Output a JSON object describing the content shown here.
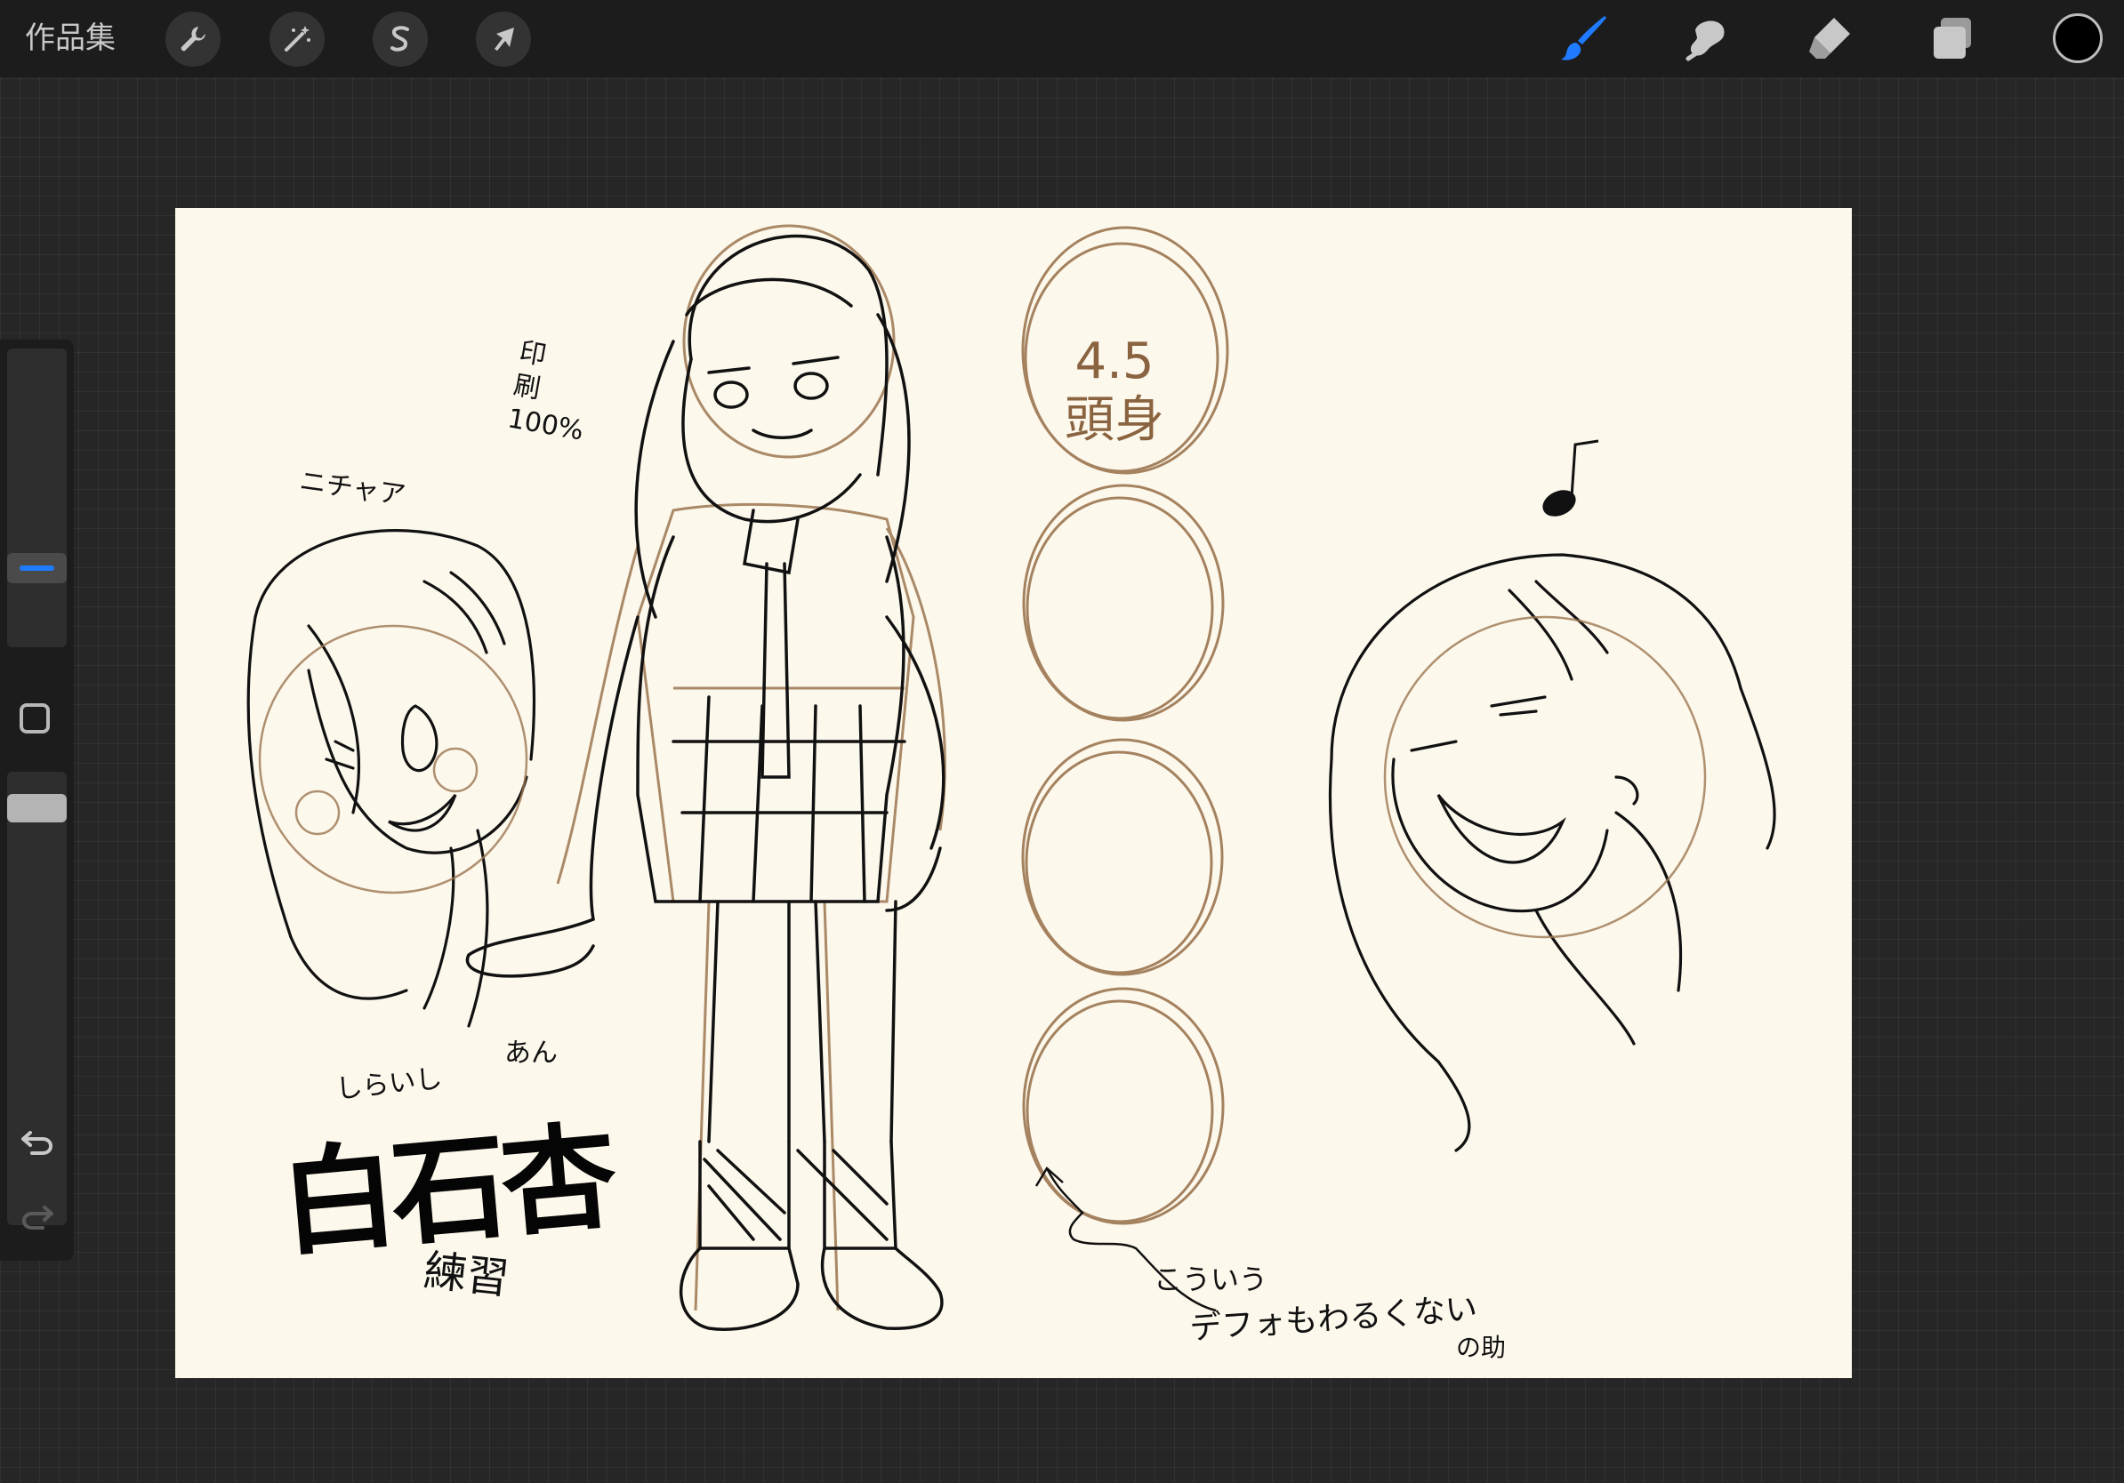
{
  "topbar": {
    "gallery_label": "作品集",
    "left_tools": [
      {
        "icon": "wrench-icon",
        "name": "actions"
      },
      {
        "icon": "magic-wand-icon",
        "name": "adjustments"
      },
      {
        "icon": "selection-s-icon",
        "name": "selection"
      },
      {
        "icon": "arrow-cursor-icon",
        "name": "transform"
      }
    ],
    "right_tools": [
      {
        "icon": "brush-icon",
        "name": "paint",
        "active": true
      },
      {
        "icon": "smudge-icon",
        "name": "smudge"
      },
      {
        "icon": "eraser-icon",
        "name": "eraser"
      },
      {
        "icon": "layers-icon",
        "name": "layers"
      }
    ],
    "current_color": "#000000"
  },
  "sidebar": {
    "brush_size_icon": "size-slider-icon",
    "modify_icon": "square-modify-icon",
    "opacity_icon": "opacity-slider-icon",
    "undo_icon": "undo-arrow-icon",
    "redo_icon": "redo-arrow-icon"
  },
  "canvas": {
    "background": "#fdf8ec",
    "notes": {
      "expression": "ニチャア",
      "print_setting": "印\n刷\n100%",
      "head_ratio": "4.5\n頭身",
      "furigana_surname": "しらいし",
      "furigana_name": "あん",
      "character_name": "白石杏",
      "practice": "練習",
      "deformed_line1": "こういう",
      "deformed_line2": "デフォもわるくない",
      "signature": "の助"
    }
  },
  "colors": {
    "accent": "#1f7bff",
    "sketch_ink": "#111111",
    "sketch_guide": "#9b7650"
  }
}
